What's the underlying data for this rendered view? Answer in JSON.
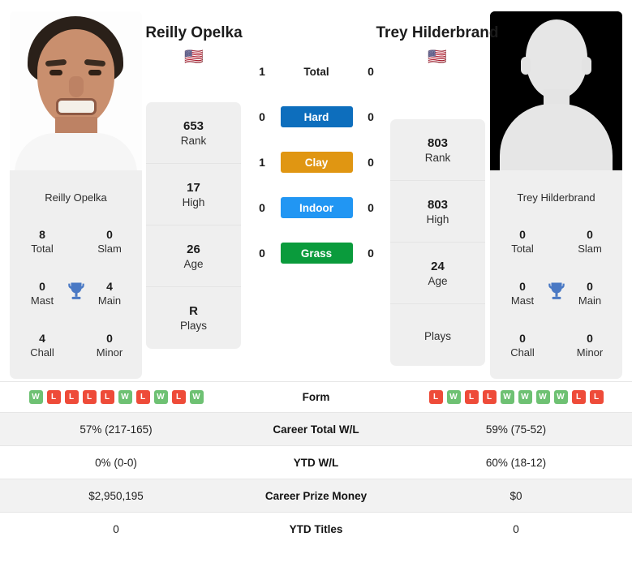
{
  "players": {
    "left": {
      "name": "Reilly Opelka",
      "flag": "🇺🇸",
      "flag_name": "flag-us",
      "photo_caption": "Reilly Opelka",
      "photo_type": "portrait-photo",
      "stack": [
        {
          "value": "653",
          "label": "Rank"
        },
        {
          "value": "17",
          "label": "High"
        },
        {
          "value": "26",
          "label": "Age"
        },
        {
          "value": "R",
          "label": "Plays"
        }
      ],
      "titles": {
        "name": "Reilly Opelka",
        "rows": [
          {
            "left_value": "8",
            "left_label": "Total",
            "right_value": "0",
            "right_label": "Slam"
          },
          {
            "left_value": "0",
            "left_label": "Mast",
            "right_value": "4",
            "right_label": "Main"
          },
          {
            "left_value": "4",
            "left_label": "Chall",
            "right_value": "0",
            "right_label": "Minor"
          }
        ]
      },
      "form": [
        "W",
        "L",
        "L",
        "L",
        "L",
        "W",
        "L",
        "W",
        "L",
        "W"
      ],
      "career_total_wl": "57% (217-165)",
      "ytd_wl": "0% (0-0)",
      "career_prize_money": "$2,950,195",
      "ytd_titles": "0"
    },
    "right": {
      "name": "Trey Hilderbrand",
      "flag": "🇺🇸",
      "flag_name": "flag-us",
      "photo_caption": "Trey Hilderbrand",
      "photo_type": "silhouette-placeholder",
      "stack": [
        {
          "value": "803",
          "label": "Rank"
        },
        {
          "value": "803",
          "label": "High"
        },
        {
          "value": "24",
          "label": "Age"
        },
        {
          "value": "",
          "label": "Plays"
        }
      ],
      "titles": {
        "name": "Trey Hilderbrand",
        "rows": [
          {
            "left_value": "0",
            "left_label": "Total",
            "right_value": "0",
            "right_label": "Slam"
          },
          {
            "left_value": "0",
            "left_label": "Mast",
            "right_value": "0",
            "right_label": "Main"
          },
          {
            "left_value": "0",
            "left_label": "Chall",
            "right_value": "0",
            "right_label": "Minor"
          }
        ]
      },
      "form": [
        "L",
        "W",
        "L",
        "L",
        "W",
        "W",
        "W",
        "W",
        "L",
        "L"
      ],
      "career_total_wl": "59% (75-52)",
      "ytd_wl": "60% (18-12)",
      "career_prize_money": "$0",
      "ytd_titles": "0"
    }
  },
  "surfaces": [
    {
      "label": "Total",
      "left": "1",
      "right": "0",
      "color": "transparent",
      "text_color": "#1b1b1b",
      "icon": "total-label"
    },
    {
      "label": "Hard",
      "left": "0",
      "right": "0",
      "color": "#0d6ebd",
      "text_color": "#ffffff",
      "icon": "hard-court-badge"
    },
    {
      "label": "Clay",
      "left": "1",
      "right": "0",
      "color": "#e09612",
      "text_color": "#ffffff",
      "icon": "clay-court-badge"
    },
    {
      "label": "Indoor",
      "left": "0",
      "right": "0",
      "color": "#2196f3",
      "text_color": "#ffffff",
      "icon": "indoor-court-badge"
    },
    {
      "label": "Grass",
      "left": "0",
      "right": "0",
      "color": "#0a9b3c",
      "text_color": "#ffffff",
      "icon": "grass-court-badge"
    }
  ],
  "table": {
    "form_label": "Form",
    "rows": [
      {
        "label": "Career Total W/L",
        "key": "career_total_wl"
      },
      {
        "label": "YTD W/L",
        "key": "ytd_wl"
      },
      {
        "label": "Career Prize Money",
        "key": "career_prize_money"
      },
      {
        "label": "YTD Titles",
        "key": "ytd_titles"
      }
    ]
  },
  "colors": {
    "win_badge": "#6ec173",
    "loss_badge": "#ee4b39",
    "card_bg": "#efefef",
    "row_alt_bg": "#f2f2f2",
    "trophy": "#4a79c4"
  }
}
